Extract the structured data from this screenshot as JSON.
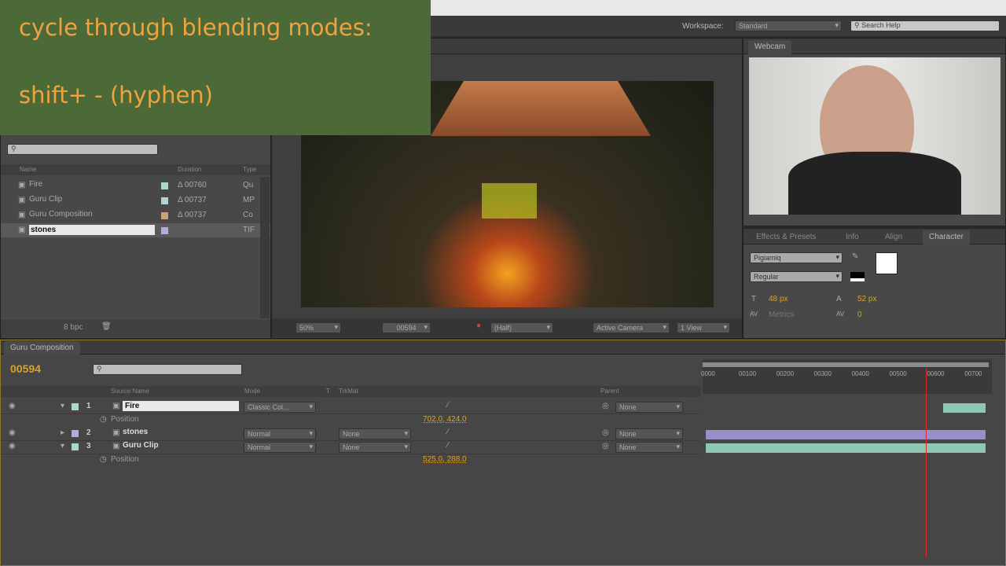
{
  "overlay": {
    "line1": "cycle through blending modes:",
    "line2": "shift+ - (hyphen)"
  },
  "toolbar": {
    "workspace_label": "Workspace:",
    "workspace_value": "Standard",
    "search_help": "Search Help"
  },
  "project": {
    "columns": {
      "name": "Name",
      "duration": "Duration",
      "type": "Type"
    },
    "items": [
      {
        "name": "Fire",
        "color": "#a8d8cc",
        "duration": "Δ 00760",
        "type": "Qu"
      },
      {
        "name": "Guru Clip",
        "color": "#a8d8cc",
        "duration": "Δ 00737",
        "type": "MP"
      },
      {
        "name": "Guru Composition",
        "color": "#c8a27a",
        "duration": "Δ 00737",
        "type": "Co"
      },
      {
        "name": "stones",
        "color": "#b8a8e0",
        "duration": "",
        "type": "TIF"
      }
    ],
    "bpc": "8 bpc"
  },
  "viewer": {
    "zoom": "50%",
    "timecode": "00594",
    "resolution": "(Half)",
    "camera": "Active Camera",
    "views": "1 View"
  },
  "webcam": {
    "tab": "Webcam"
  },
  "character": {
    "tabs": [
      "Effects & Presets",
      "Info",
      "Align",
      "Character"
    ],
    "font": "Pigiamiq",
    "style": "Regular",
    "size": "48 px",
    "leading": "52 px",
    "kerning": "Metrics",
    "tracking": "0"
  },
  "timeline": {
    "tab": "Guru Composition",
    "timecode": "00594",
    "columns": {
      "source": "Source Name",
      "mode": "Mode",
      "t": "T",
      "trkmat": "TrkMat",
      "parent": "Parent"
    },
    "ruler": [
      "0000",
      "00100",
      "00200",
      "00300",
      "00400",
      "00500",
      "00600",
      "00700"
    ],
    "playhead_frame": 594,
    "layers": [
      {
        "num": "1",
        "name": "Fire",
        "color": "#a8d8cc",
        "mode": "Classic Col...",
        "trkmat": "",
        "parent": "None",
        "prop": "Position",
        "value": "702.0, 424.0",
        "bar_start": 630,
        "bar_end": 760,
        "bar_color": "#8fc7b5"
      },
      {
        "num": "2",
        "name": "stones",
        "color": "#b8a8e0",
        "mode": "Normal",
        "trkmat": "None",
        "parent": "None",
        "bar_start": 0,
        "bar_end": 760,
        "bar_color": "#9a8ec8"
      },
      {
        "num": "3",
        "name": "Guru Clip",
        "color": "#a8d8cc",
        "mode": "Normal",
        "trkmat": "None",
        "parent": "None",
        "prop": "Position",
        "value": "525.0, 288.0",
        "bar_start": 0,
        "bar_end": 760,
        "bar_color": "#8fc7b5"
      }
    ]
  }
}
